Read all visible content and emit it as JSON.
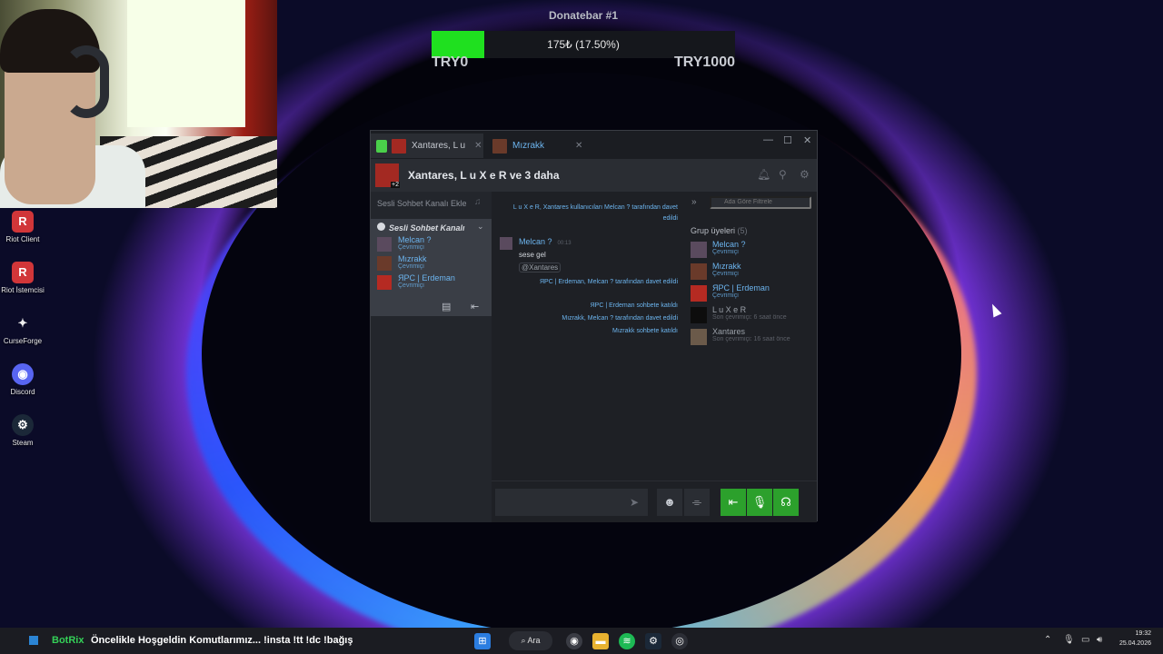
{
  "donatebar": {
    "title": "Donatebar #1",
    "progress_text": "175₺ (17.50%)",
    "progress_fraction": 0.175,
    "min_label": "TRY0",
    "max_label": "TRY1000",
    "fill_color": "#1fe01f"
  },
  "desktop_icons": [
    {
      "label": "Riot Client",
      "icon": "riot-client-icon",
      "color": "#d13639",
      "glyph": "R"
    },
    {
      "label": "Riot İstemcisi",
      "icon": "riot-client-icon",
      "color": "#d13639",
      "glyph": "R"
    },
    {
      "label": "CurseForge",
      "icon": "curseforge-icon",
      "color": "#e8e8e8",
      "glyph": "✦"
    },
    {
      "label": "Discord",
      "icon": "discord-icon",
      "color": "#5865f2",
      "glyph": "◉"
    },
    {
      "label": "Steam",
      "icon": "steam-icon",
      "color": "#1b2838",
      "glyph": "⚙"
    }
  ],
  "chat": {
    "tabs": [
      {
        "label": "Xantares, L u",
        "active": true
      },
      {
        "label": "Mızrakk",
        "active": false
      }
    ],
    "group_title": "Xantares, L u X e R ve 3 daha",
    "group_avatar_badge": "+2",
    "voice": {
      "add_channel": "Sesli Sohbet Kanalı Ekle",
      "channel_title": "Sesli Sohbet Kanalı",
      "members": [
        {
          "name": "Melcan ?",
          "status": "Çevrimiçi",
          "color": "#5a4a5e"
        },
        {
          "name": "Mızrakk",
          "status": "Çevrimiçi",
          "color": "#6a3a2a"
        },
        {
          "name": "ЯPC | Erdeman",
          "status": "Çevrimiçi",
          "color": "#b52a22"
        }
      ]
    },
    "messages": {
      "sys1": "L u X e R, Xantares kullanıcıları Melcan ? tarafından davet edildi",
      "author": "Melcan ?",
      "time": "00:13",
      "text": "sese gel",
      "mention": "@Xantares",
      "sys2": "ЯPC | Erdeman, Melcan ? tarafından davet edildi",
      "sys3": "ЯPC | Erdeman sohbete katıldı",
      "sys4": "Mızrakk, Melcan ? tarafından davet edildi",
      "sys5": "Mızrakk sohbete katıldı"
    },
    "members_panel": {
      "filter_placeholder": "Ada Göre Filtrele",
      "group_label": "Grup üyeleri",
      "group_count": "(5)",
      "members": [
        {
          "name": "Melcan ?",
          "status": "Çevrimiçi",
          "online": true,
          "color": "#5a4a5e"
        },
        {
          "name": "Mızrakk",
          "status": "Çevrimiçi",
          "online": true,
          "color": "#6a3a2a"
        },
        {
          "name": "ЯPC | Erdeman",
          "status": "Çevrimiçi",
          "online": true,
          "color": "#b52a22"
        },
        {
          "name": "L u X e R",
          "status": "Son çevrimiçi: 6 saat önce",
          "online": false,
          "color": "#0d0d0d"
        },
        {
          "name": "Xantares",
          "status": "Son çevrimiçi: 16 saat önce",
          "online": false,
          "color": "#6b5a4a"
        }
      ]
    }
  },
  "taskbar": {
    "brand": "BotRix",
    "ticker": "Öncelikle Hoşgeldin Komutlarımız... !insta !tt !dc !bağış",
    "search": "Ara",
    "time": "19:32",
    "date": "25.04.2026"
  }
}
